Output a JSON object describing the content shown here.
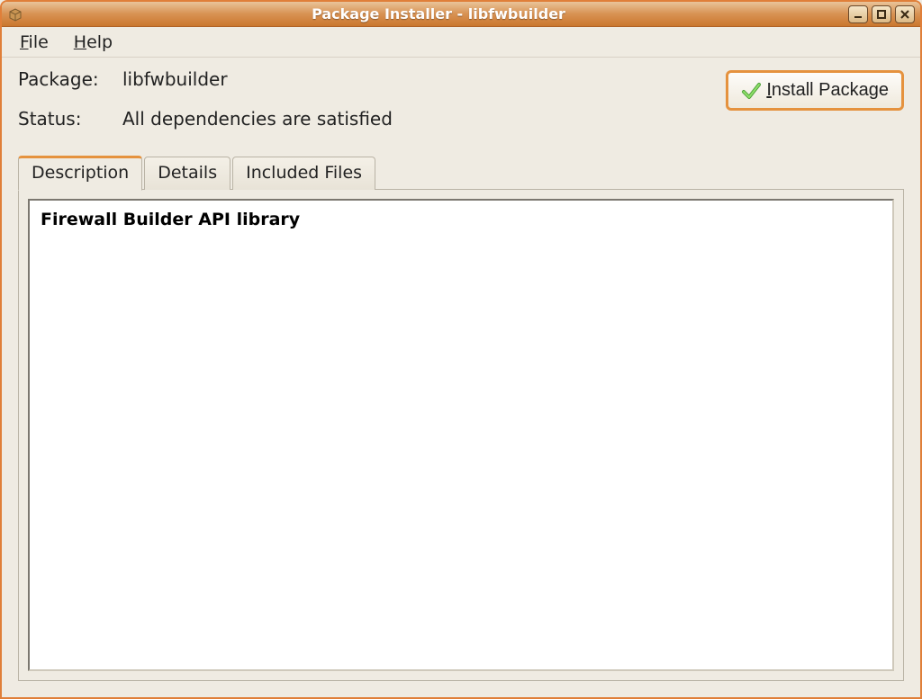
{
  "window": {
    "title": "Package Installer - libfwbuilder"
  },
  "menubar": {
    "file": "File",
    "help": "Help"
  },
  "info": {
    "package_label": "Package:",
    "package_value": "libfwbuilder",
    "status_label": "Status:",
    "status_value": "All dependencies are satisfied"
  },
  "actions": {
    "install": "Install Package"
  },
  "tabs": {
    "description": "Description",
    "details": "Details",
    "included_files": "Included Files"
  },
  "description": {
    "heading": "Firewall Builder API library"
  }
}
